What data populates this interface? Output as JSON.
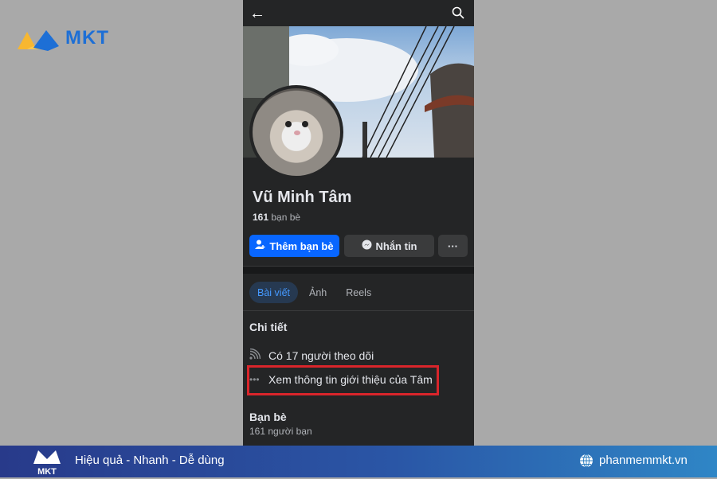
{
  "brand": {
    "logo_text": "MKT",
    "footer_slogan": "Hiệu quả - Nhanh - Dễ dùng",
    "website": "phanmemmkt.vn",
    "footer_logo_text": "MKT",
    "highlight_color": "#d9252b",
    "accent": "#0866ff"
  },
  "profile": {
    "topbar": {
      "back_icon": "arrow-left-icon",
      "search_icon": "search-icon"
    },
    "name": "Vũ Minh Tâm",
    "friend_count": "161",
    "friend_label": "bạn bè",
    "actions": {
      "add_friend": "Thêm bạn bè",
      "message": "Nhắn tin",
      "more": "···"
    },
    "tabs": [
      {
        "label": "Bài viết",
        "active": true
      },
      {
        "label": "Ảnh"
      },
      {
        "label": "Reels"
      }
    ],
    "details": {
      "title": "Chi tiết",
      "followers": "Có 17 người theo dõi",
      "about": "Xem thông tin giới thiệu của Tâm"
    },
    "friends_section": {
      "title": "Bạn bè",
      "count": "161 người bạn"
    }
  }
}
